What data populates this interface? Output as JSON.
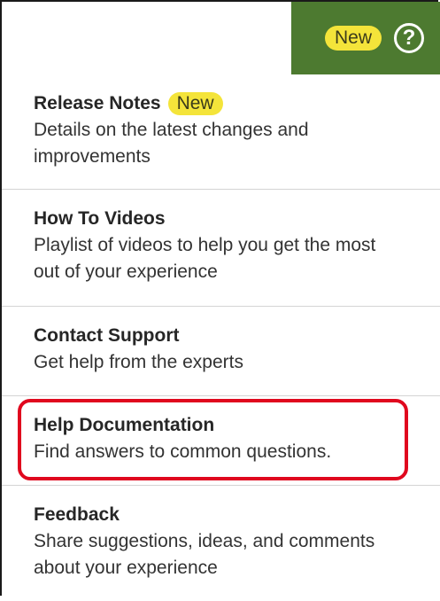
{
  "header": {
    "new_badge": "New",
    "help_icon_glyph": "?",
    "bar_color": "#4d7a30",
    "badge_color": "#f4e43a"
  },
  "menu": {
    "items": [
      {
        "title": "Release Notes",
        "badge": "New",
        "desc_line1": "Details on the latest changes and",
        "desc_line2": "improvements"
      },
      {
        "title": "How To Videos",
        "desc_line1": "Playlist of videos to help you get the most",
        "desc_line2": "out of your experience"
      },
      {
        "title": "Contact Support",
        "desc_line1": "Get help from the experts"
      },
      {
        "title": "Help Documentation",
        "desc_line1": "Find answers to common questions."
      },
      {
        "title": "Feedback",
        "desc_line1": "Share suggestions, ideas, and comments",
        "desc_line2": "about your experience"
      }
    ]
  },
  "annotation": {
    "highlight_color": "#e0081e"
  }
}
